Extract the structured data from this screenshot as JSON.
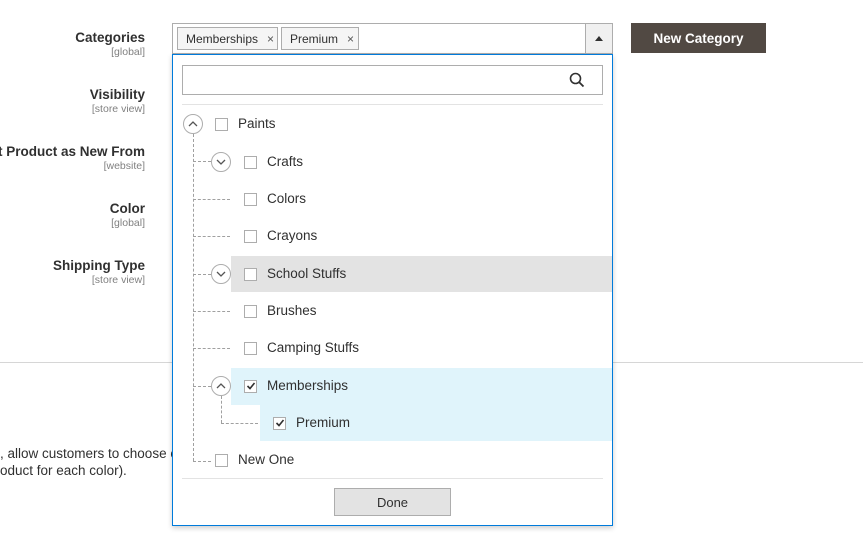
{
  "fields": [
    {
      "label": "Categories",
      "scope": "[global]"
    },
    {
      "label": "Visibility",
      "scope": "[store view]"
    },
    {
      "label": "et Product as New From",
      "scope": "[website]"
    },
    {
      "label": "Color",
      "scope": "[global]"
    },
    {
      "label": "Shipping Type",
      "scope": "[store view]"
    }
  ],
  "side_text": {
    "line1": ", allow customers to choose o",
    "line2": "oduct for each color)."
  },
  "new_category_button": "New Category",
  "selected_chips": [
    "Memberships",
    "Premium"
  ],
  "chip_remove_glyph": "×",
  "search": {
    "placeholder": "",
    "value": ""
  },
  "tree": [
    {
      "label": "Paints",
      "checked": false,
      "expandable": true,
      "expanded": true
    },
    {
      "label": "Crafts",
      "checked": false,
      "expandable": true,
      "expanded": false
    },
    {
      "label": "Colors",
      "checked": false,
      "expandable": false
    },
    {
      "label": "Crayons",
      "checked": false,
      "expandable": false
    },
    {
      "label": "School Stuffs",
      "checked": false,
      "expandable": true,
      "expanded": false,
      "hovered": true
    },
    {
      "label": "Brushes",
      "checked": false,
      "expandable": false
    },
    {
      "label": "Camping Stuffs",
      "checked": false,
      "expandable": false
    },
    {
      "label": "Memberships",
      "checked": true,
      "expandable": true,
      "expanded": true
    },
    {
      "label": "Premium",
      "checked": true,
      "expandable": false
    },
    {
      "label": "New One",
      "checked": false,
      "expandable": false
    }
  ],
  "done_button": "Done",
  "colors": {
    "accent_border": "#007bdb",
    "dark_button": "#514943",
    "selected_row": "#e0f4fb",
    "hover_row": "#e3e3e3"
  }
}
